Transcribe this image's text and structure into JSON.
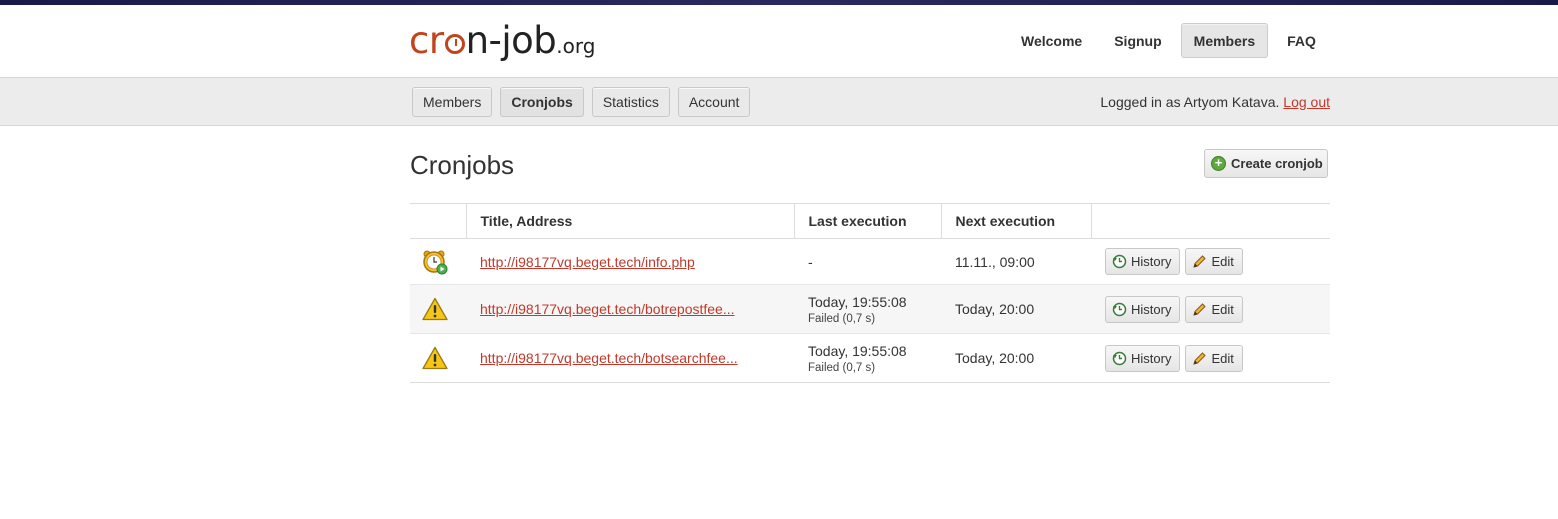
{
  "logo": {
    "part1": "cr",
    "part2": "n-job",
    "suffix": ".org"
  },
  "topnav": [
    {
      "label": "Welcome",
      "active": false
    },
    {
      "label": "Signup",
      "active": false
    },
    {
      "label": "Members",
      "active": true
    },
    {
      "label": "FAQ",
      "active": false
    }
  ],
  "subnav": [
    {
      "label": "Members",
      "active": false
    },
    {
      "label": "Cronjobs",
      "active": true
    },
    {
      "label": "Statistics",
      "active": false
    },
    {
      "label": "Account",
      "active": false
    }
  ],
  "login": {
    "prefix": "Logged in as Artyom Katava.",
    "logout": "Log out"
  },
  "page": {
    "title": "Cronjobs",
    "create_label": "Create cronjob"
  },
  "table": {
    "headers": {
      "title": "Title, Address",
      "last": "Last execution",
      "next": "Next execution"
    },
    "rows": [
      {
        "status_icon": "clock-active-icon",
        "url": "http://i98177vq.beget.tech/info.php",
        "last": "-",
        "last_status": "",
        "next": "11.11., 09:00"
      },
      {
        "status_icon": "warning-icon",
        "url": "http://i98177vq.beget.tech/botrepostfee...",
        "last": "Today, 19:55:08",
        "last_status": "Failed (0,7 s)",
        "next": "Today, 20:00"
      },
      {
        "status_icon": "warning-icon",
        "url": "http://i98177vq.beget.tech/botsearchfee...",
        "last": "Today, 19:55:08",
        "last_status": "Failed (0,7 s)",
        "next": "Today, 20:00"
      }
    ],
    "history_label": "History",
    "edit_label": "Edit"
  },
  "colors": {
    "accent": "#c0392b",
    "logo": "#c0441c",
    "bar": "#ececec"
  }
}
